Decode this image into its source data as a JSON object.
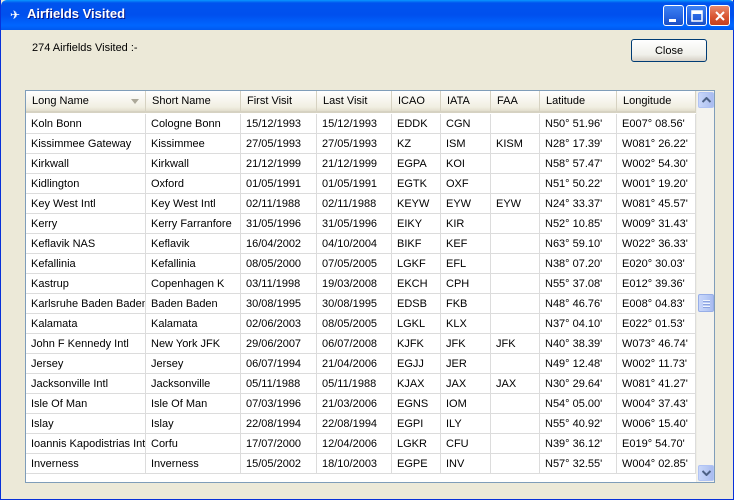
{
  "window": {
    "title": "Airfields Visited"
  },
  "summary": {
    "count_label": "274 Airfields Visited :-"
  },
  "buttons": {
    "close_label": "Close"
  },
  "table": {
    "columns": [
      "Long Name",
      "Short Name",
      "First Visit",
      "Last Visit",
      "ICAO",
      "IATA",
      "FAA",
      "Latitude",
      "Longitude"
    ],
    "rows": [
      [
        "Koln Bonn",
        "Cologne Bonn",
        "15/12/1993",
        "15/12/1993",
        "EDDK",
        "CGN",
        "",
        "N50° 51.96'",
        "E007° 08.56'"
      ],
      [
        "Kissimmee Gateway",
        "Kissimmee",
        "27/05/1993",
        "27/05/1993",
        "KZ",
        "ISM",
        "KISM",
        "N28° 17.39'",
        "W081° 26.22'"
      ],
      [
        "Kirkwall",
        "Kirkwall",
        "21/12/1999",
        "21/12/1999",
        "EGPA",
        "KOI",
        "",
        "N58° 57.47'",
        "W002° 54.30'"
      ],
      [
        "Kidlington",
        "Oxford",
        "01/05/1991",
        "01/05/1991",
        "EGTK",
        "OXF",
        "",
        "N51° 50.22'",
        "W001° 19.20'"
      ],
      [
        "Key West Intl",
        "Key West Intl",
        "02/11/1988",
        "02/11/1988",
        "KEYW",
        "EYW",
        "EYW",
        "N24° 33.37'",
        "W081° 45.57'"
      ],
      [
        "Kerry",
        "Kerry Farranfore",
        "31/05/1996",
        "31/05/1996",
        "EIKY",
        "KIR",
        "",
        "N52° 10.85'",
        "W009° 31.43'"
      ],
      [
        "Keflavik NAS",
        "Keflavik",
        "16/04/2002",
        "04/10/2004",
        "BIKF",
        "KEF",
        "",
        "N63° 59.10'",
        "W022° 36.33'"
      ],
      [
        "Kefallinia",
        "Kefallinia",
        "08/05/2000",
        "07/05/2005",
        "LGKF",
        "EFL",
        "",
        "N38° 07.20'",
        "E020° 30.03'"
      ],
      [
        "Kastrup",
        "Copenhagen K",
        "03/11/1998",
        "19/03/2008",
        "EKCH",
        "CPH",
        "",
        "N55° 37.08'",
        "E012° 39.36'"
      ],
      [
        "Karlsruhe Baden Baden",
        "Baden Baden",
        "30/08/1995",
        "30/08/1995",
        "EDSB",
        "FKB",
        "",
        "N48° 46.76'",
        "E008° 04.83'"
      ],
      [
        "Kalamata",
        "Kalamata",
        "02/06/2003",
        "08/05/2005",
        "LGKL",
        "KLX",
        "",
        "N37° 04.10'",
        "E022° 01.53'"
      ],
      [
        "John F Kennedy Intl",
        "New York JFK",
        "29/06/2007",
        "06/07/2008",
        "KJFK",
        "JFK",
        "JFK",
        "N40° 38.39'",
        "W073° 46.74'"
      ],
      [
        "Jersey",
        "Jersey",
        "06/07/1994",
        "21/04/2006",
        "EGJJ",
        "JER",
        "",
        "N49° 12.48'",
        "W002° 11.73'"
      ],
      [
        "Jacksonville Intl",
        "Jacksonville",
        "05/11/1988",
        "05/11/1988",
        "KJAX",
        "JAX",
        "JAX",
        "N30° 29.64'",
        "W081° 41.27'"
      ],
      [
        "Isle Of Man",
        "Isle Of Man",
        "07/03/1996",
        "21/03/2006",
        "EGNS",
        "IOM",
        "",
        "N54° 05.00'",
        "W004° 37.43'"
      ],
      [
        "Islay",
        "Islay",
        "22/08/1994",
        "22/08/1994",
        "EGPI",
        "ILY",
        "",
        "N55° 40.92'",
        "W006° 15.40'"
      ],
      [
        "Ioannis Kapodistrias Intl",
        "Corfu",
        "17/07/2000",
        "12/04/2006",
        "LGKR",
        "CFU",
        "",
        "N39° 36.12'",
        "E019° 54.70'"
      ],
      [
        "Inverness",
        "Inverness",
        "15/05/2002",
        "18/10/2003",
        "EGPE",
        "INV",
        "",
        "N57° 32.55'",
        "W004° 02.85'"
      ]
    ]
  }
}
